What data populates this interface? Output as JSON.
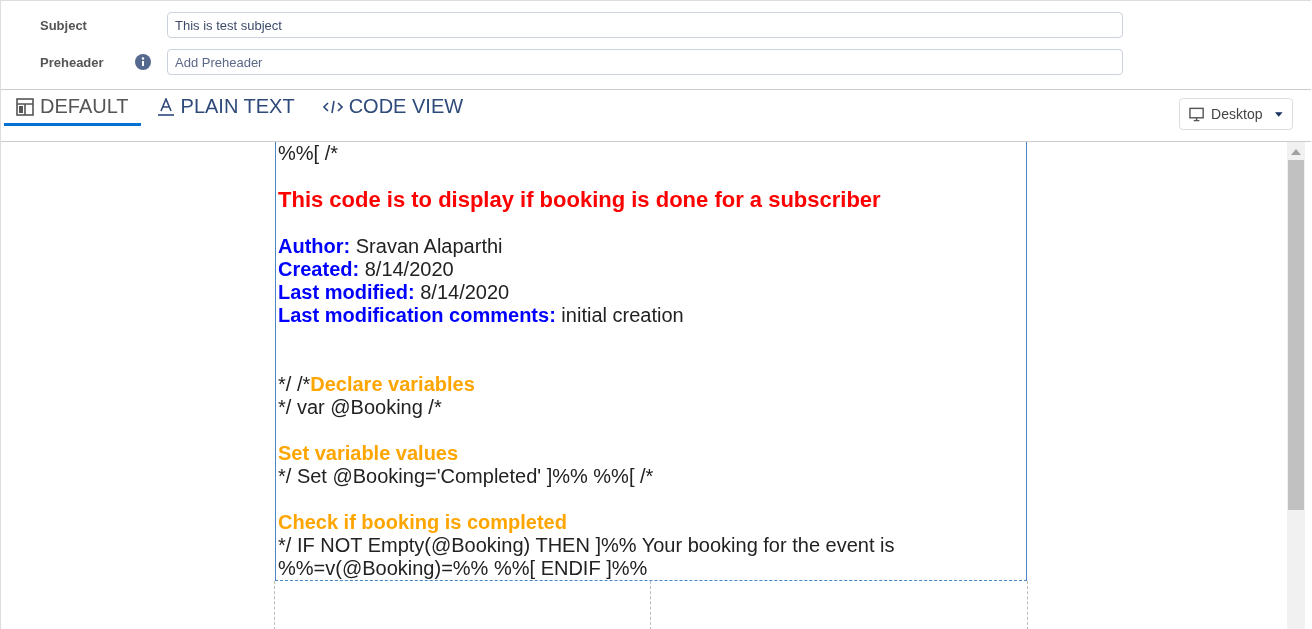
{
  "fields": [
    {
      "label": "Subject",
      "info": false,
      "value": "This is test subject"
    },
    {
      "label": "Preheader",
      "info": true,
      "placeholder": "Add Preheader"
    }
  ],
  "tabs": [
    {
      "label": "DEFAULT",
      "kind": "layout",
      "selected": true
    },
    {
      "label": "PLAIN TEXT",
      "kind": "text",
      "selected": false
    },
    {
      "label": "CODE VIEW",
      "kind": "code",
      "selected": false
    }
  ],
  "device_select": {
    "value": "Desktop"
  },
  "content_lines": [
    {
      "kind": "line",
      "parts": [
        {
          "kind": "code",
          "text": "%%[ /*"
        }
      ]
    },
    {
      "kind": "blank"
    },
    {
      "kind": "line",
      "parts": [
        {
          "kind": "heading",
          "text": "This code is to display if booking is done for a subscriber"
        }
      ]
    },
    {
      "kind": "blank"
    },
    {
      "kind": "line",
      "parts": [
        {
          "kind": "label",
          "text": "Author:"
        },
        {
          "kind": "code",
          "text": " Sravan Alaparthi"
        }
      ]
    },
    {
      "kind": "line",
      "parts": [
        {
          "kind": "label",
          "text": "Created:"
        },
        {
          "kind": "code",
          "text": " 8/14/2020"
        }
      ]
    },
    {
      "kind": "line",
      "parts": [
        {
          "kind": "label",
          "text": "Last modified:"
        },
        {
          "kind": "code",
          "text": " 8/14/2020"
        }
      ]
    },
    {
      "kind": "line",
      "parts": [
        {
          "kind": "label",
          "text": "Last modification comments:"
        },
        {
          "kind": "code",
          "text": " initial creation"
        }
      ]
    },
    {
      "kind": "blank"
    },
    {
      "kind": "blank"
    },
    {
      "kind": "line",
      "parts": [
        {
          "kind": "code",
          "text": "*/ /*"
        },
        {
          "kind": "section",
          "text": "Declare variables"
        }
      ]
    },
    {
      "kind": "line",
      "parts": [
        {
          "kind": "code",
          "text": "*/ var @Booking /*"
        }
      ]
    },
    {
      "kind": "blank"
    },
    {
      "kind": "line",
      "parts": [
        {
          "kind": "section",
          "text": "Set variable values"
        }
      ]
    },
    {
      "kind": "line",
      "parts": [
        {
          "kind": "code",
          "text": "*/ Set @Booking='Completed' ]%% %%[ /*"
        }
      ]
    },
    {
      "kind": "blank"
    },
    {
      "kind": "line",
      "parts": [
        {
          "kind": "section",
          "text": "Check if booking is completed"
        }
      ]
    },
    {
      "kind": "line",
      "parts": [
        {
          "kind": "code",
          "text": "*/ IF NOT Empty(@Booking) THEN ]%% Your booking for the event is"
        }
      ]
    },
    {
      "kind": "line",
      "parts": [
        {
          "kind": "code",
          "text": "%%=v(@Booking)=%% %%[ ENDIF ]%%"
        }
      ]
    }
  ]
}
